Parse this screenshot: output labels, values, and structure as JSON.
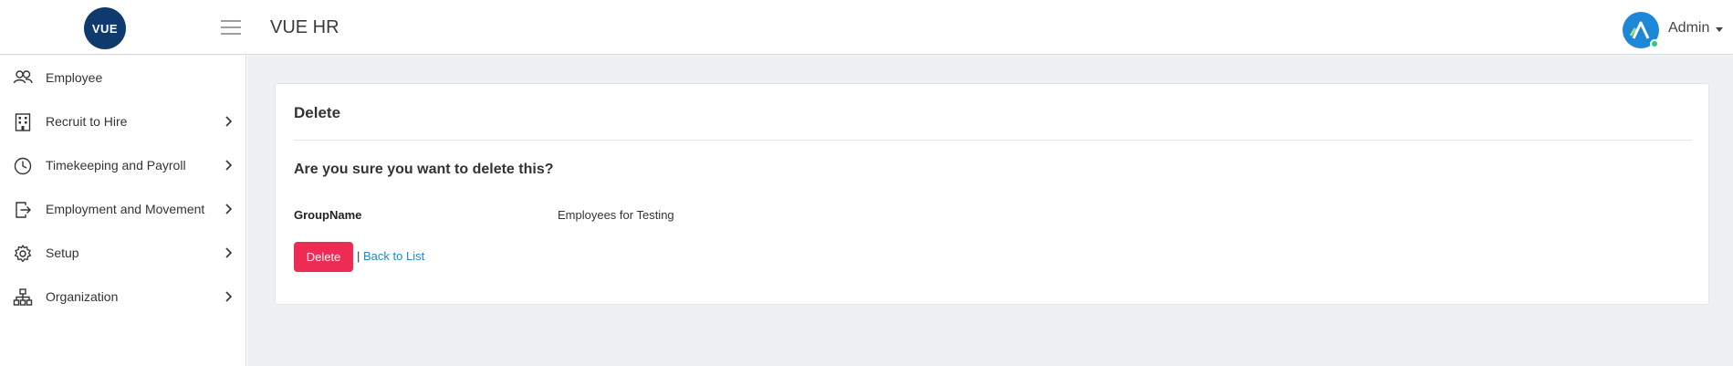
{
  "header": {
    "logo_text": "VUE",
    "app_title": "VUE HR",
    "user_name": "Admin",
    "brand_color": "#0f3a6e",
    "avatar_color": "#1e88d8"
  },
  "sidebar": {
    "items": [
      {
        "label": "Employee",
        "icon": "users-icon",
        "has_chevron": false
      },
      {
        "label": "Recruit to Hire",
        "icon": "building-icon",
        "has_chevron": true
      },
      {
        "label": "Timekeeping and Payroll",
        "icon": "clock-icon",
        "has_chevron": true
      },
      {
        "label": "Employment and Movement",
        "icon": "exit-door-icon",
        "has_chevron": true
      },
      {
        "label": "Setup",
        "icon": "gear-icon",
        "has_chevron": true
      },
      {
        "label": "Organization",
        "icon": "org-chart-icon",
        "has_chevron": true
      }
    ]
  },
  "main": {
    "card_title": "Delete",
    "confirm_question": "Are you sure you want to delete this?",
    "field_label": "GroupName",
    "field_value": "Employees for Testing",
    "delete_button_label": "Delete",
    "separator": "|",
    "back_link_label": "Back to List",
    "delete_color": "#ee2b53",
    "link_color": "#1e88c8"
  }
}
